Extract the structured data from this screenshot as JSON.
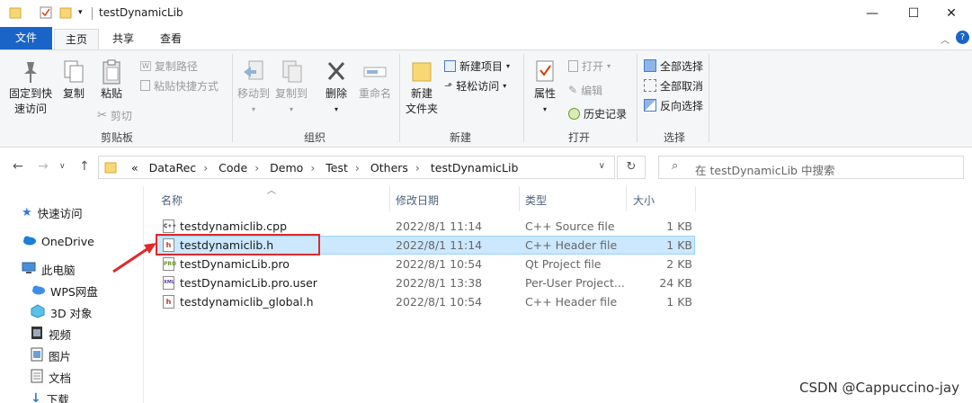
{
  "window": {
    "title": "testDynamicLib",
    "minimize": "—",
    "maximize": "☐",
    "close": "✕"
  },
  "tabs": {
    "file": "文件",
    "home": "主页",
    "share": "共享",
    "view": "查看"
  },
  "ribbon": {
    "clipboard": {
      "pin": "固定到快速访问",
      "pin_line1": "固定到快",
      "pin_line2": "速访问",
      "copy": "复制",
      "paste": "粘贴",
      "copy_path": "复制路径",
      "paste_shortcut": "粘贴快捷方式",
      "cut": "剪切",
      "label": "剪贴板"
    },
    "organize": {
      "move_to": "移动到",
      "copy_to": "复制到",
      "delete": "删除",
      "rename": "重命名",
      "label": "组织"
    },
    "new": {
      "new_folder_line1": "新建",
      "new_folder_line2": "文件夹",
      "new_item": "新建项目",
      "easy_access": "轻松访问",
      "label": "新建"
    },
    "open": {
      "properties": "属性",
      "open": "打开",
      "edit": "编辑",
      "history": "历史记录",
      "label": "打开"
    },
    "select": {
      "select_all": "全部选择",
      "select_none": "全部取消",
      "invert": "反向选择",
      "label": "选择"
    }
  },
  "address": {
    "crumbs": [
      "«",
      "DataRec",
      "Code",
      "Demo",
      "Test",
      "Others",
      "testDynamicLib"
    ],
    "search_placeholder": "在 testDynamicLib 中搜索"
  },
  "nav": [
    {
      "label": "快速访问",
      "icon": "star-icon"
    },
    {
      "label": "OneDrive",
      "icon": "cloud-icon"
    },
    {
      "label": "此电脑",
      "icon": "computer-icon"
    },
    {
      "label": "WPS网盘",
      "icon": "wps-cloud-icon"
    },
    {
      "label": "3D 对象",
      "icon": "cube-icon"
    },
    {
      "label": "视频",
      "icon": "video-icon"
    },
    {
      "label": "图片",
      "icon": "picture-icon"
    },
    {
      "label": "文档",
      "icon": "document-icon"
    },
    {
      "label": "下载",
      "icon": "download-icon"
    }
  ],
  "columns": {
    "name": "名称",
    "date": "修改日期",
    "type": "类型",
    "size": "大小"
  },
  "files": [
    {
      "name": "testdynamiclib.cpp",
      "date": "2022/8/1 11:14",
      "type": "C++ Source file",
      "size": "1 KB",
      "icon": "cpp-file-icon",
      "badge": "C++"
    },
    {
      "name": "testdynamiclib.h",
      "date": "2022/8/1 11:14",
      "type": "C++ Header file",
      "size": "1 KB",
      "icon": "header-file-icon",
      "badge": "h"
    },
    {
      "name": "testDynamicLib.pro",
      "date": "2022/8/1 10:54",
      "type": "Qt Project file",
      "size": "2 KB",
      "icon": "pro-file-icon",
      "badge": "PRO"
    },
    {
      "name": "testDynamicLib.pro.user",
      "date": "2022/8/1 13:38",
      "type": "Per-User Project...",
      "size": "24 KB",
      "icon": "user-file-icon",
      "badge": "XML"
    },
    {
      "name": "testdynamiclib_global.h",
      "date": "2022/8/1 10:54",
      "type": "C++ Header file",
      "size": "1 KB",
      "icon": "header-file-icon",
      "badge": "h"
    }
  ],
  "watermark": "CSDN @Cappuccino-jay",
  "colors": {
    "accent": "#1a64c8",
    "selection": "#cce8ff",
    "highlight_box": "#e0282b"
  }
}
